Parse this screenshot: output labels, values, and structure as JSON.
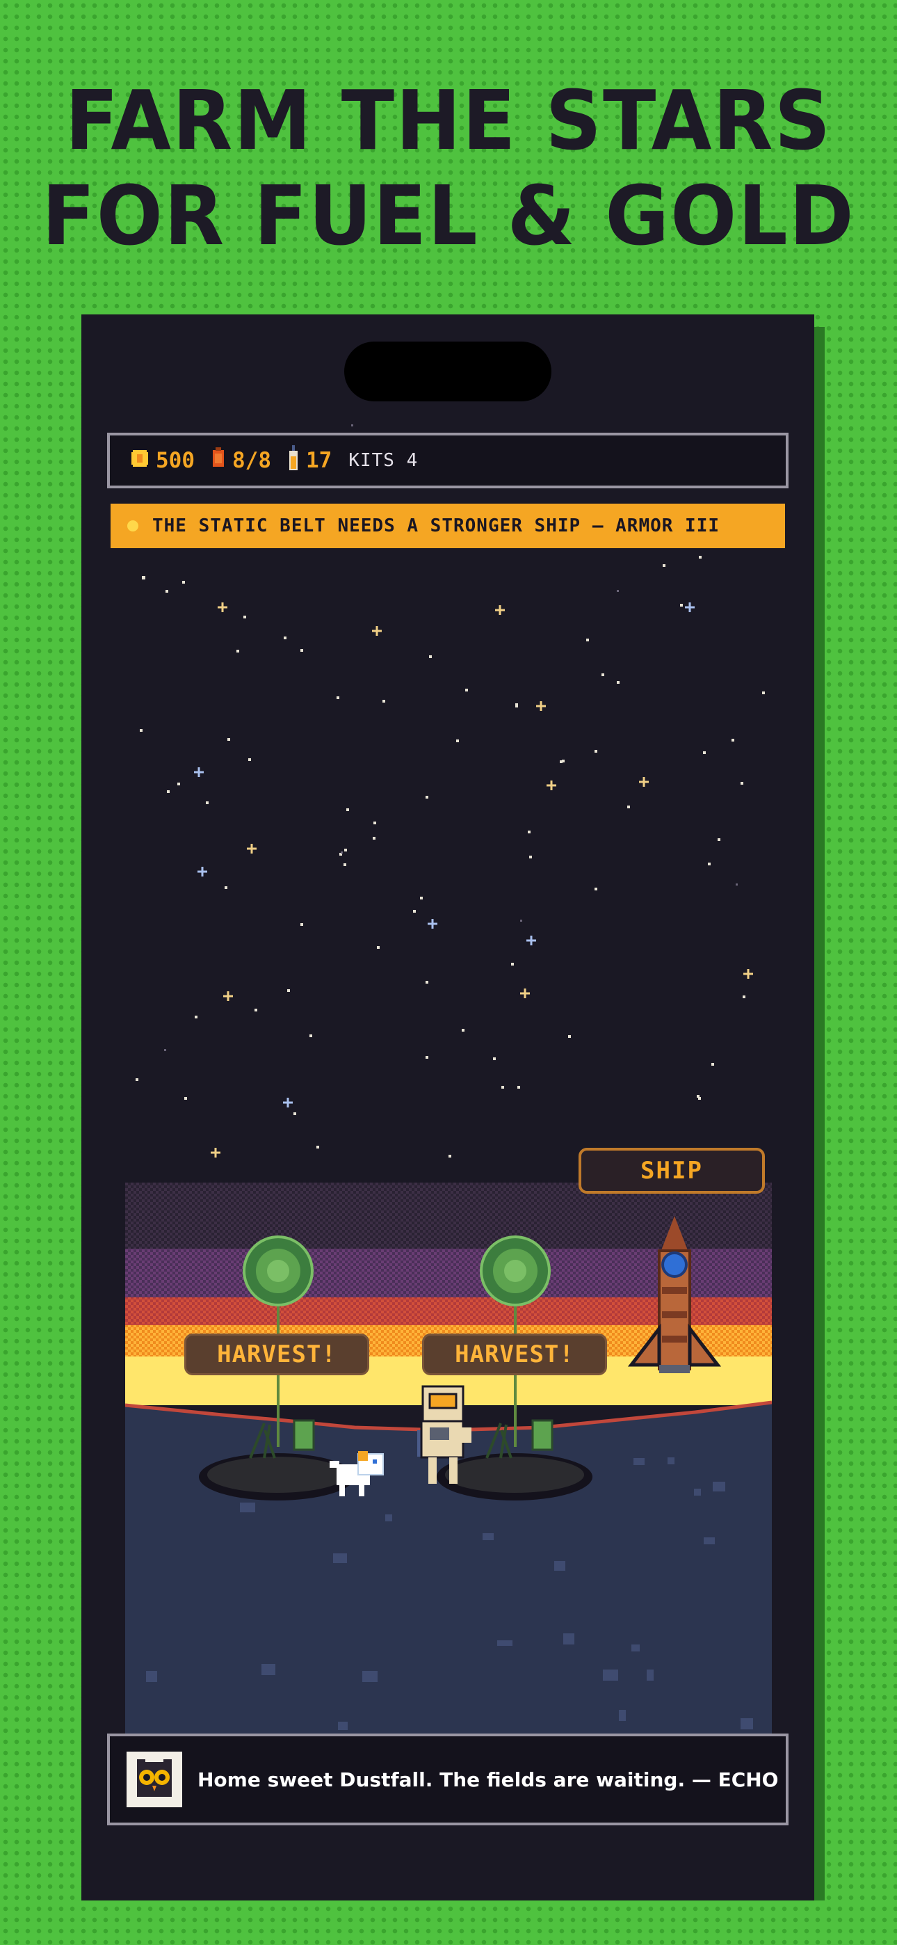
{
  "headline": {
    "line1": "FARM THE STARS",
    "line2": "FOR FUEL & GOLD"
  },
  "hud": {
    "coins": "500",
    "fuel": "8/8",
    "bottles": "17",
    "kits": "KITS 4",
    "icons": [
      "coin-icon",
      "fuel-can-icon",
      "bottle-icon"
    ]
  },
  "banner": {
    "text": "THE STATIC BELT NEEDS A STRONGER SHIP — ARMOR III"
  },
  "scene": {
    "ship_label": "SHIP",
    "plots": [
      {
        "label": "HARVEST!"
      },
      {
        "label": "HARVEST!"
      }
    ]
  },
  "dialog": {
    "speaker_icon": "owl-icon",
    "text": "Home sweet Dustfall. The fields are waiting. — ECHO"
  },
  "colors": {
    "background": "#4fc23f",
    "phone": "#1a1824",
    "accent": "#f5a623",
    "ground": "#2c3550"
  }
}
